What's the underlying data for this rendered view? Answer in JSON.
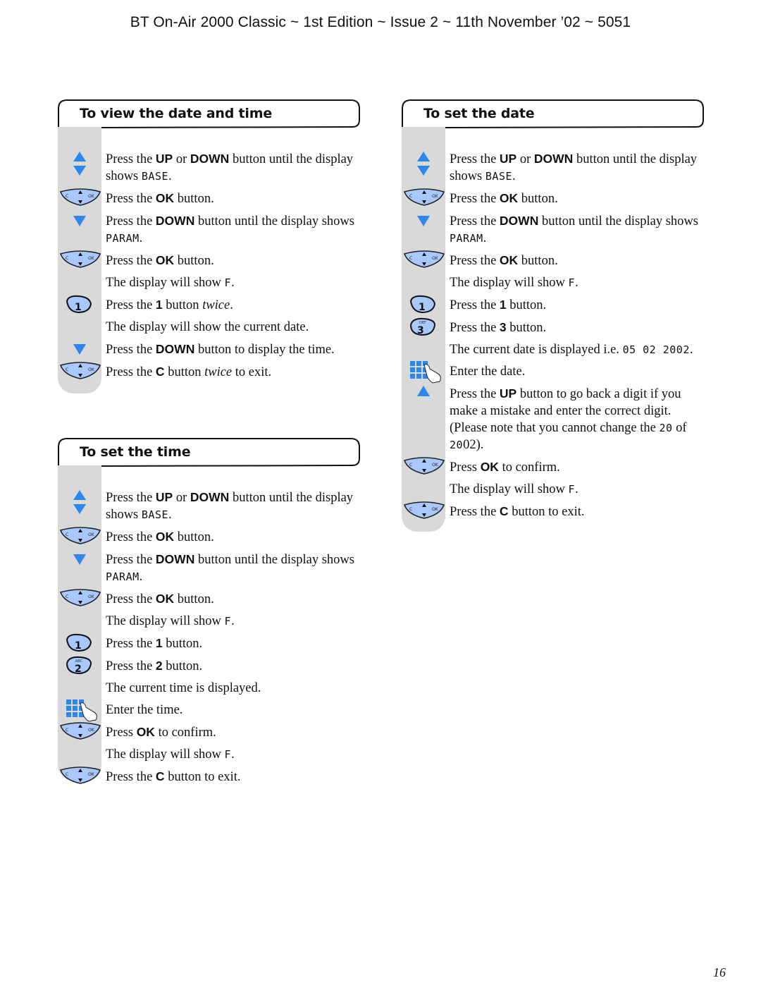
{
  "header": {
    "title": "BT On-Air 2000 Classic ~ 1st Edition ~ Issue 2 ~ 11th November ’02 ~ 5051"
  },
  "page_number": "16",
  "colors": {
    "icon_blue": "#2e86e8",
    "key_fill": "#a9c8ff",
    "gutter": "#d9d9d9"
  },
  "sections": {
    "view": {
      "title": "To view the date and time",
      "steps": [
        {
          "icon": "up-down-arrows-icon",
          "parts": [
            "Press the ",
            "UP",
            " or ",
            "DOWN",
            " button until the display shows ",
            "BASE",
            "."
          ]
        },
        {
          "icon": "nav-key-icon",
          "parts": [
            "Press the ",
            "OK",
            " button."
          ]
        },
        {
          "icon": "down-arrow-icon",
          "parts": [
            "Press the ",
            "DOWN",
            " button until the display shows ",
            "PARAM",
            "."
          ]
        },
        {
          "icon": "nav-key-icon",
          "parts": [
            "Press the ",
            "OK",
            " button."
          ]
        },
        {
          "icon": "",
          "parts": [
            "The display will show ",
            "F",
            "."
          ]
        },
        {
          "icon": "key-1-icon",
          "parts": [
            "Press the ",
            "1",
            " button ",
            "twice",
            "."
          ]
        },
        {
          "icon": "",
          "parts": [
            "The display will show the current date."
          ]
        },
        {
          "icon": "down-arrow-icon",
          "parts": [
            "Press the ",
            "DOWN",
            " button to display the time."
          ]
        },
        {
          "icon": "nav-key-icon",
          "parts": [
            "Press the ",
            "C",
            " button ",
            "twice",
            " to exit."
          ]
        }
      ]
    },
    "time": {
      "title": "To set the time",
      "steps": [
        {
          "icon": "up-down-arrows-icon",
          "parts": [
            "Press the ",
            "UP",
            " or ",
            "DOWN",
            " button until the display shows ",
            "BASE",
            "."
          ]
        },
        {
          "icon": "nav-key-icon",
          "parts": [
            "Press the ",
            "OK",
            " button."
          ]
        },
        {
          "icon": "down-arrow-icon",
          "parts": [
            "Press the ",
            "DOWN",
            " button until the display shows ",
            "PARAM",
            "."
          ]
        },
        {
          "icon": "nav-key-icon",
          "parts": [
            "Press the ",
            "OK",
            " button."
          ]
        },
        {
          "icon": "",
          "parts": [
            "The display will show ",
            "F",
            "."
          ]
        },
        {
          "icon": "key-1-icon",
          "parts": [
            "Press the ",
            "1",
            " button."
          ]
        },
        {
          "icon": "key-2-icon",
          "parts": [
            "Press the ",
            "2",
            " button."
          ]
        },
        {
          "icon": "",
          "parts": [
            "The current time is displayed."
          ]
        },
        {
          "icon": "keypad-icon",
          "parts": [
            "Enter the time."
          ]
        },
        {
          "icon": "nav-key-icon",
          "parts": [
            "Press ",
            "OK",
            " to confirm."
          ]
        },
        {
          "icon": "",
          "parts": [
            "The display will show ",
            "F",
            "."
          ]
        },
        {
          "icon": "nav-key-icon",
          "parts": [
            "Press the ",
            "C",
            " button to exit."
          ]
        }
      ]
    },
    "date": {
      "title": "To set the date",
      "steps": [
        {
          "icon": "up-down-arrows-icon",
          "parts": [
            "Press the ",
            "UP",
            " or ",
            "DOWN",
            " button until the display shows ",
            "BASE",
            "."
          ]
        },
        {
          "icon": "nav-key-icon",
          "parts": [
            "Press the ",
            "OK",
            " button."
          ]
        },
        {
          "icon": "down-arrow-icon",
          "parts": [
            "Press the ",
            "DOWN",
            " button until the display shows ",
            "PARAM",
            "."
          ]
        },
        {
          "icon": "nav-key-icon",
          "parts": [
            "Press the ",
            "OK",
            " button."
          ]
        },
        {
          "icon": "",
          "parts": [
            "The display will show ",
            "F",
            "."
          ]
        },
        {
          "icon": "key-1-icon",
          "parts": [
            "Press the ",
            "1",
            " button."
          ]
        },
        {
          "icon": "key-3-icon",
          "parts": [
            "Press the ",
            "3",
            " button."
          ]
        },
        {
          "icon": "",
          "parts": [
            "The current date is displayed i.e. ",
            "05 02 2002",
            "."
          ]
        },
        {
          "icon": "keypad-icon",
          "parts": [
            "Enter the date."
          ]
        },
        {
          "icon": "up-arrow-icon",
          "parts": [
            "Press the ",
            "UP",
            " button to go back a digit if you make a mistake and enter the correct digit. (Please note that you cannot change the ",
            "20",
            " of ",
            "20",
            "02",
            ")."
          ]
        },
        {
          "icon": "nav-key-icon",
          "parts": [
            "Press ",
            "OK",
            " to confirm."
          ]
        },
        {
          "icon": "",
          "parts": [
            "The display will show ",
            "F",
            "."
          ]
        },
        {
          "icon": "nav-key-icon",
          "parts": [
            "Press the ",
            "C",
            " button to exit."
          ]
        }
      ]
    }
  }
}
